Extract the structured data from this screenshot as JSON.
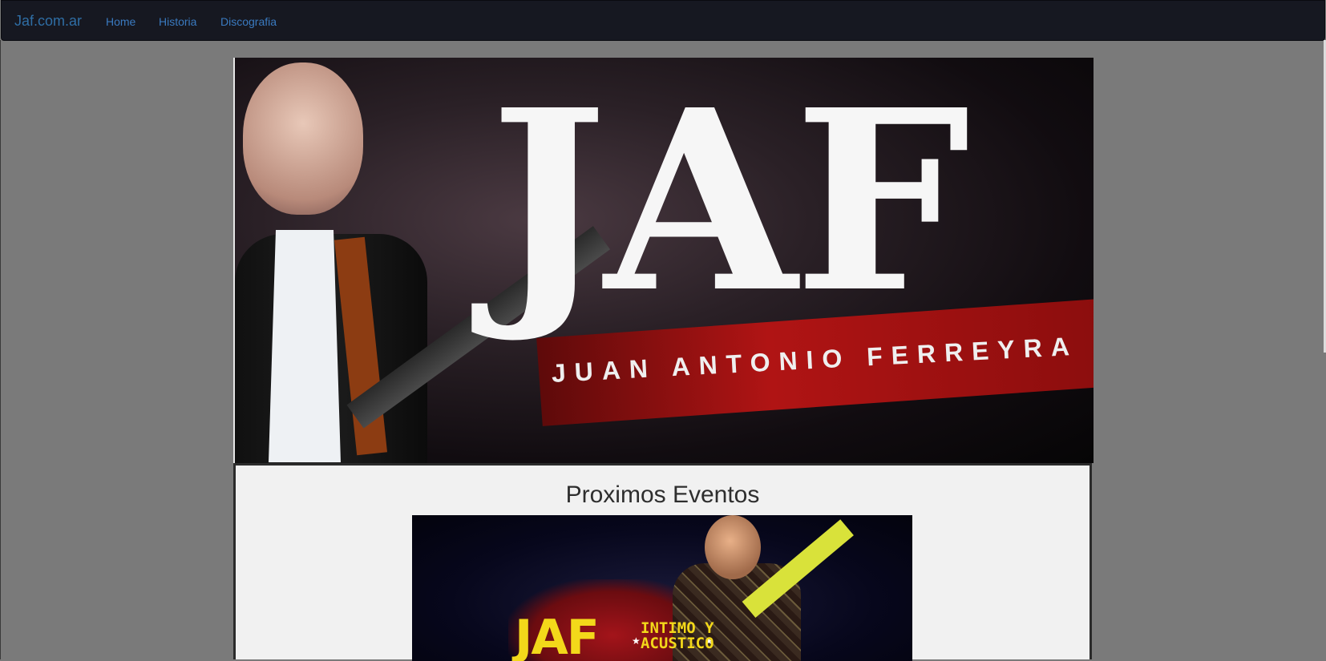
{
  "navbar": {
    "brand": "Jaf.com.ar",
    "links": [
      "Home",
      "Historia",
      "Discografia"
    ]
  },
  "hero": {
    "logo_text": "JAF",
    "subtitle": "JUAN ANTONIO FERREYRA"
  },
  "events": {
    "title": "Proximos Eventos",
    "poster": {
      "logo_text": "JAF",
      "tag_line_1": "INTIMO Y",
      "tag_line_2": "ACUSTICO"
    }
  },
  "colors": {
    "navbar_bg": "#161821",
    "link": "#3a7ac0",
    "page_bg": "#7a7a7a",
    "content_bg": "#f1f1f1"
  }
}
